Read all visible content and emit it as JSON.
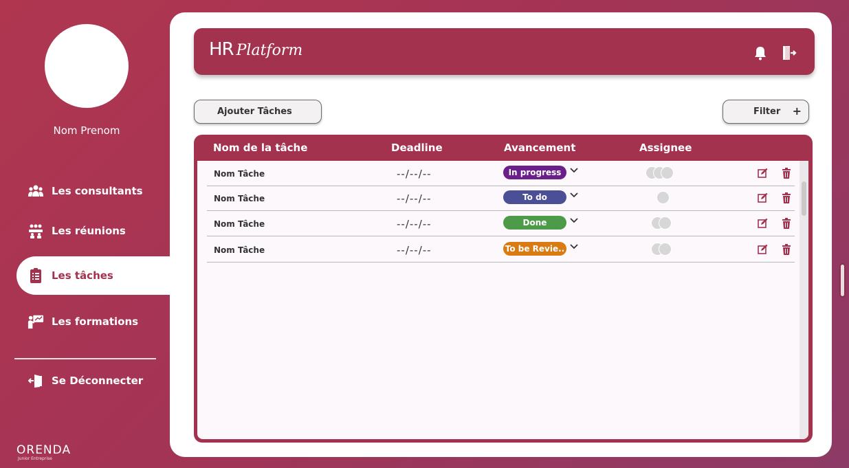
{
  "sidebar": {
    "user_name": "Nom Prenom",
    "items": [
      {
        "label": "Les consultants",
        "icon": "users-group-icon"
      },
      {
        "label": "Les réunions",
        "icon": "meeting-icon"
      },
      {
        "label": "Les tâches",
        "icon": "clipboard-icon",
        "active": true
      },
      {
        "label": "Les formations",
        "icon": "training-icon"
      }
    ],
    "logout_label": "Se Déconnecter",
    "logo": "ORENDA",
    "logo_sub": "Junior Entreprise"
  },
  "header": {
    "brand_hr": "HR",
    "brand_platform": "Platform"
  },
  "toolbar": {
    "add_label": "Ajouter Tâches",
    "filter_label": "Filter",
    "filter_plus": "+"
  },
  "table": {
    "columns": [
      "Nom de la tâche",
      "Deadline",
      "Avancement",
      "Assignee"
    ],
    "rows": [
      {
        "name": "Nom Tâche",
        "deadline": "--/--/--",
        "status": "In progress",
        "status_color": "#6a1f8a",
        "assignees": 3
      },
      {
        "name": "Nom Tâche",
        "deadline": "--/--/--",
        "status": "To do",
        "status_color": "#4a4f96",
        "assignees": 1
      },
      {
        "name": "Nom Tâche",
        "deadline": "--/--/--",
        "status": "Done",
        "status_color": "#4d9a48",
        "assignees": 2
      },
      {
        "name": "Nom Tâche",
        "deadline": "--/--/--",
        "status": "To be Revie..",
        "status_color": "#d97a12",
        "assignees": 2
      }
    ]
  },
  "colors": {
    "accent": "#a3324f",
    "background": "#a43455"
  }
}
